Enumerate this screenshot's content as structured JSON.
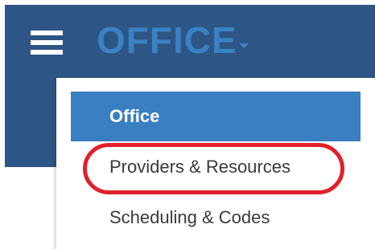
{
  "header": {
    "brand_label": "OFFICE",
    "brand_color": "#3b82c4",
    "background_color": "#2d5585"
  },
  "menu": {
    "items": [
      {
        "label": "Office",
        "active": true
      },
      {
        "label": "Providers & Resources",
        "active": false
      },
      {
        "label": "Scheduling & Codes",
        "active": false
      }
    ],
    "active_color": "#3a7fc1"
  },
  "annotation": {
    "highlight_color": "#e0202a"
  },
  "icons": {
    "menu": "hamburger-menu-icon",
    "dropdown": "caret-down-icon"
  }
}
